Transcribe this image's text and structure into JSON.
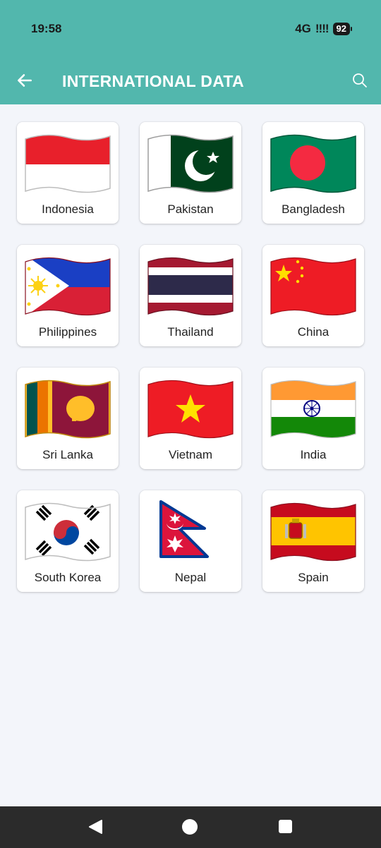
{
  "status": {
    "time": "19:58",
    "network": "4G",
    "signal": "!!!!",
    "battery": "92"
  },
  "header": {
    "title": "INTERNATIONAL DATA"
  },
  "countries": [
    {
      "name": "Indonesia"
    },
    {
      "name": "Pakistan"
    },
    {
      "name": "Bangladesh"
    },
    {
      "name": "Philippines"
    },
    {
      "name": "Thailand"
    },
    {
      "name": "China"
    },
    {
      "name": "Sri Lanka"
    },
    {
      "name": "Vietnam"
    },
    {
      "name": "India"
    },
    {
      "name": "South Korea"
    },
    {
      "name": "Nepal"
    },
    {
      "name": "Spain"
    }
  ],
  "icons": {
    "back": "arrow-left-icon",
    "search": "search-icon",
    "nav_back": "triangle-back-icon",
    "nav_home": "circle-home-icon",
    "nav_recent": "square-recent-icon"
  }
}
